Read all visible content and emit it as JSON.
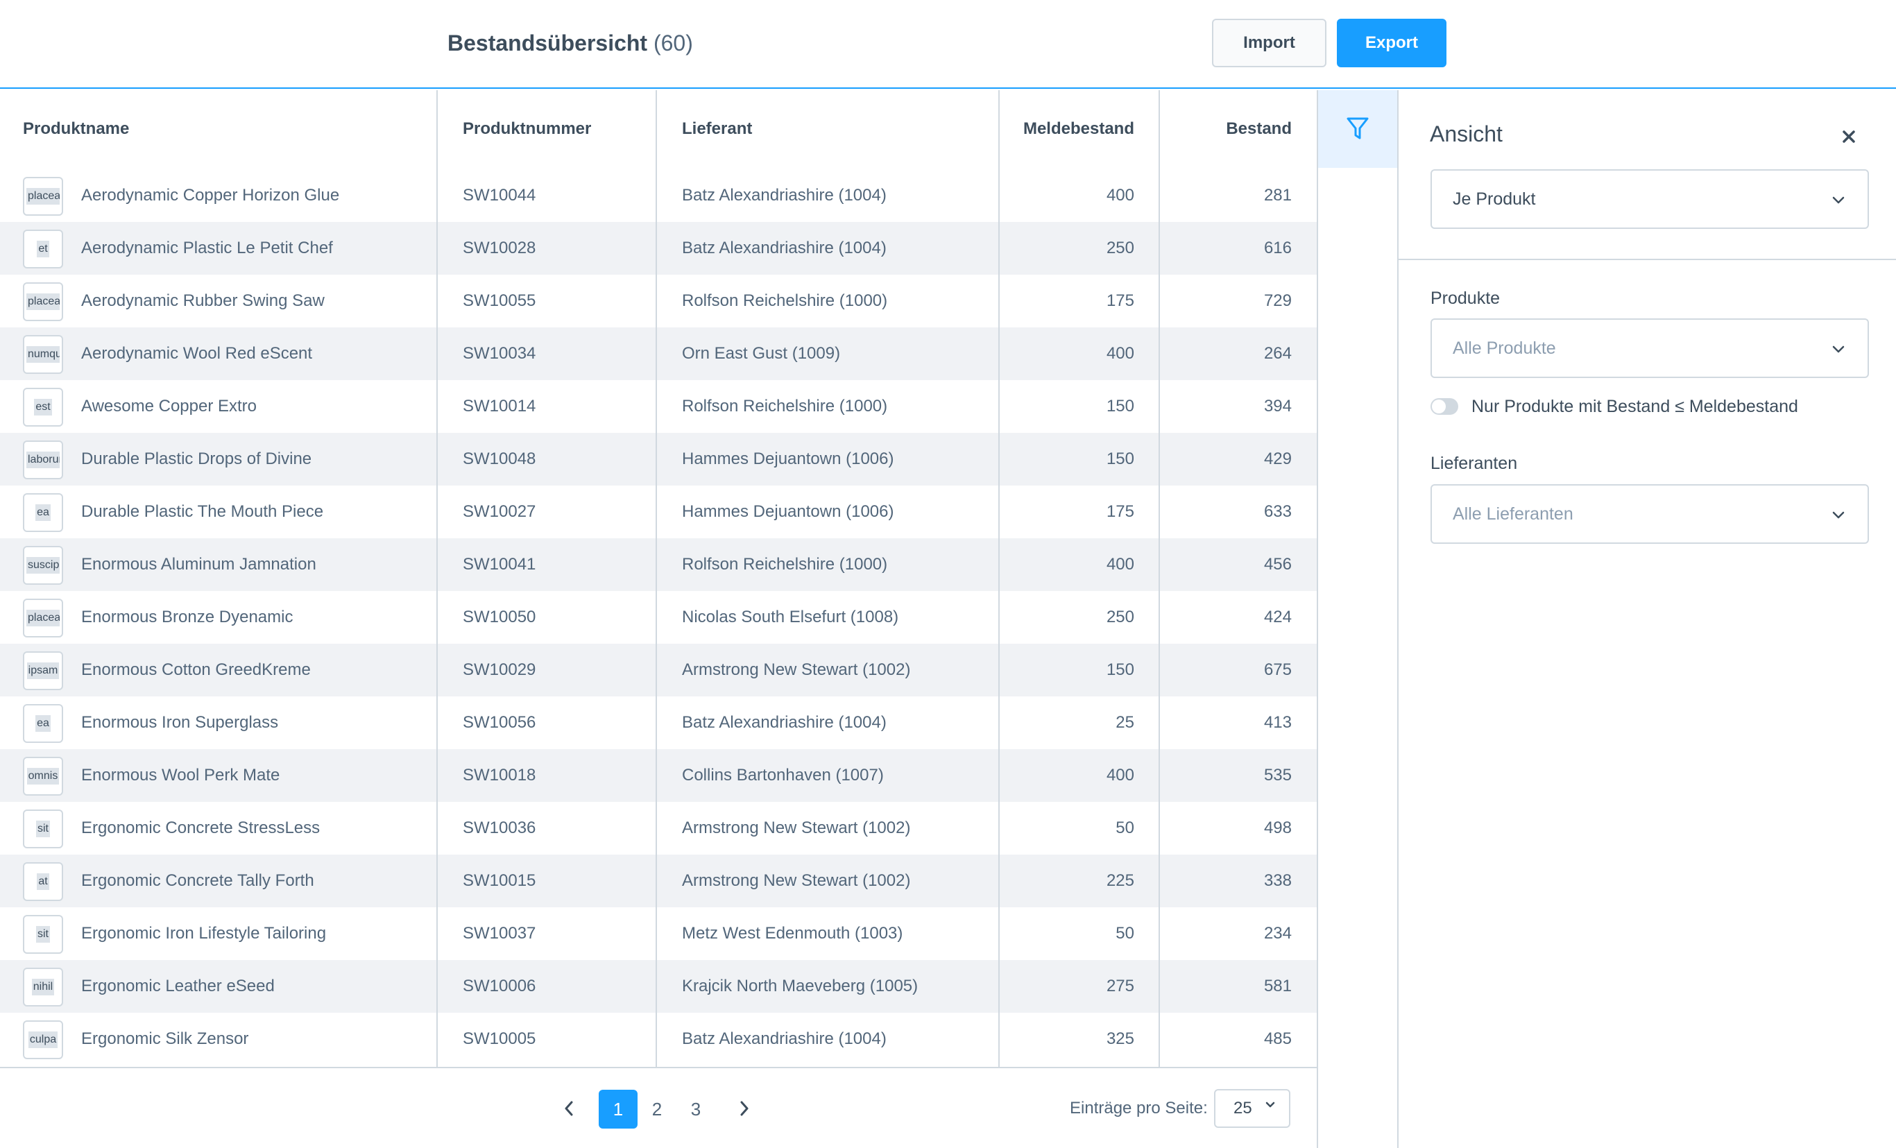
{
  "header": {
    "title": "Bestandsübersicht",
    "count": "(60)",
    "import_label": "Import",
    "export_label": "Export"
  },
  "table": {
    "columns": {
      "name": "Produktname",
      "number": "Produktnummer",
      "supplier": "Lieferant",
      "min_stock": "Meldebestand",
      "stock": "Bestand"
    },
    "rows": [
      {
        "thumb": "placeat",
        "name": "Aerodynamic Copper Horizon Glue",
        "number": "SW10044",
        "supplier": "Batz Alexandriashire (1004)",
        "min_stock": "400",
        "stock": "281"
      },
      {
        "thumb": "et",
        "name": "Aerodynamic Plastic Le Petit Chef",
        "number": "SW10028",
        "supplier": "Batz Alexandriashire (1004)",
        "min_stock": "250",
        "stock": "616"
      },
      {
        "thumb": "placeat",
        "name": "Aerodynamic Rubber Swing Saw",
        "number": "SW10055",
        "supplier": "Rolfson Reichelshire (1000)",
        "min_stock": "175",
        "stock": "729"
      },
      {
        "thumb": "numquam",
        "name": "Aerodynamic Wool Red eScent",
        "number": "SW10034",
        "supplier": "Orn East Gust (1009)",
        "min_stock": "400",
        "stock": "264"
      },
      {
        "thumb": "est",
        "name": "Awesome Copper Extro",
        "number": "SW10014",
        "supplier": "Rolfson Reichelshire (1000)",
        "min_stock": "150",
        "stock": "394"
      },
      {
        "thumb": "laborum",
        "name": "Durable Plastic Drops of Divine",
        "number": "SW10048",
        "supplier": "Hammes Dejuantown (1006)",
        "min_stock": "150",
        "stock": "429"
      },
      {
        "thumb": "ea",
        "name": "Durable Plastic The Mouth Piece",
        "number": "SW10027",
        "supplier": "Hammes Dejuantown (1006)",
        "min_stock": "175",
        "stock": "633"
      },
      {
        "thumb": "suscipit",
        "name": "Enormous Aluminum Jamnation",
        "number": "SW10041",
        "supplier": "Rolfson Reichelshire (1000)",
        "min_stock": "400",
        "stock": "456"
      },
      {
        "thumb": "placeat",
        "name": "Enormous Bronze Dyenamic",
        "number": "SW10050",
        "supplier": "Nicolas South Elsefurt (1008)",
        "min_stock": "250",
        "stock": "424"
      },
      {
        "thumb": "ipsam",
        "name": "Enormous Cotton GreedKreme",
        "number": "SW10029",
        "supplier": "Armstrong New Stewart (1002)",
        "min_stock": "150",
        "stock": "675"
      },
      {
        "thumb": "ea",
        "name": "Enormous Iron Superglass",
        "number": "SW10056",
        "supplier": "Batz Alexandriashire (1004)",
        "min_stock": "25",
        "stock": "413"
      },
      {
        "thumb": "omnis",
        "name": "Enormous Wool Perk Mate",
        "number": "SW10018",
        "supplier": "Collins Bartonhaven (1007)",
        "min_stock": "400",
        "stock": "535"
      },
      {
        "thumb": "sit",
        "name": "Ergonomic Concrete StressLess",
        "number": "SW10036",
        "supplier": "Armstrong New Stewart (1002)",
        "min_stock": "50",
        "stock": "498"
      },
      {
        "thumb": "at",
        "name": "Ergonomic Concrete Tally Forth",
        "number": "SW10015",
        "supplier": "Armstrong New Stewart (1002)",
        "min_stock": "225",
        "stock": "338"
      },
      {
        "thumb": "sit",
        "name": "Ergonomic Iron Lifestyle Tailoring",
        "number": "SW10037",
        "supplier": "Metz West Edenmouth (1003)",
        "min_stock": "50",
        "stock": "234"
      },
      {
        "thumb": "nihil",
        "name": "Ergonomic Leather eSeed",
        "number": "SW10006",
        "supplier": "Krajcik North Maeveberg (1005)",
        "min_stock": "275",
        "stock": "581"
      },
      {
        "thumb": "culpa",
        "name": "Ergonomic Silk Zensor",
        "number": "SW10005",
        "supplier": "Batz Alexandriashire (1004)",
        "min_stock": "325",
        "stock": "485"
      }
    ]
  },
  "pagination": {
    "prev_icon": "chevron-left-icon",
    "next_icon": "chevron-right-icon",
    "pages": [
      "1",
      "2",
      "3"
    ],
    "active_page": "1",
    "per_page_label": "Einträge pro Seite:",
    "per_page_value": "25"
  },
  "filter": {
    "icon": "funnel-icon"
  },
  "panel": {
    "title": "Ansicht",
    "close_icon": "close-icon",
    "view_select_value": "Je Produkt",
    "products_label": "Produkte",
    "products_placeholder": "Alle Produkte",
    "toggle_label": "Nur Produkte mit Bestand ≤ Meldebestand",
    "suppliers_label": "Lieferanten",
    "suppliers_placeholder": "Alle Lieferanten"
  },
  "colors": {
    "accent": "#189eff",
    "text": "#52667a",
    "border": "#d1d9e0",
    "row_alt": "#f0f2f5"
  }
}
